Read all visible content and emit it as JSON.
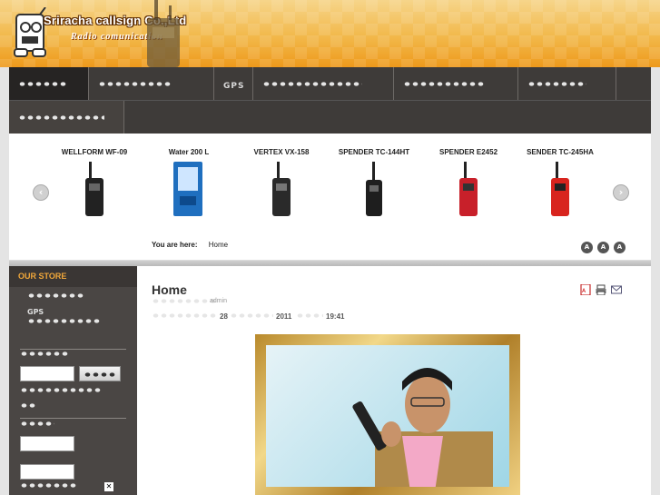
{
  "header": {
    "logo_title": "Sriracha callsign Co.,Ltd",
    "logo_sub": "Radio comunication"
  },
  "nav": {
    "row1": [
      {
        "label": "",
        "dots": 5,
        "active": true
      },
      {
        "label": "",
        "dots": 8
      },
      {
        "label": "GPS"
      },
      {
        "label": "",
        "dots": 12
      },
      {
        "label": "",
        "dots": 10
      },
      {
        "label": "",
        "dots": 7
      },
      {
        "label": ""
      }
    ],
    "row2": [
      {
        "label": "",
        "dots": 10
      }
    ]
  },
  "slider": {
    "products": [
      {
        "name": "WELLFORM WF-09",
        "color": "#222"
      },
      {
        "name": "Water 200 L",
        "color": "#1f6fbf"
      },
      {
        "name": "VERTEX VX-158",
        "color": "#222"
      },
      {
        "name": "SPENDER TC-144HT",
        "color": "#222"
      },
      {
        "name": "SPENDER E2452",
        "color": "#c8202a"
      },
      {
        "name": "SENDER TC-245HA",
        "color": "#d8241e"
      }
    ],
    "you_are_here": "You are here:",
    "breadcrumb": "Home",
    "font_buttons": [
      "A",
      "A",
      "A"
    ]
  },
  "sidebar": {
    "title": "OUR STORE",
    "gps": "GPS"
  },
  "main": {
    "title": "Home",
    "author": "admin",
    "date_day": "28",
    "date_year": "2011",
    "time": "19:41",
    "icons": [
      "pdf-icon",
      "print-icon",
      "email-icon"
    ]
  },
  "colors": {
    "header_orange": "#f2b84a",
    "nav_bg": "#3e3b39",
    "sidebar_title": "#f0a73a"
  }
}
